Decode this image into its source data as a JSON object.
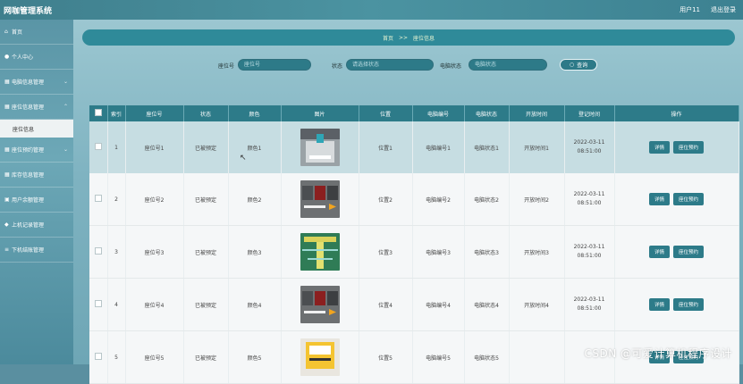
{
  "app": {
    "title": "网咖管理系统",
    "user": "用户11",
    "logout": "退出登录"
  },
  "sidebar": {
    "items": [
      {
        "label": "首页",
        "icon": "home-icon"
      },
      {
        "label": "个人中心",
        "icon": "user-icon"
      },
      {
        "label": "电脑信息管理",
        "icon": "grid-icon"
      },
      {
        "label": "座位信息管理",
        "icon": "grid-icon"
      },
      {
        "label": "座位预约管理",
        "icon": "grid-icon"
      },
      {
        "label": "库存信息管理",
        "icon": "grid-icon"
      },
      {
        "label": "用户余额管理",
        "icon": "wallet-icon"
      },
      {
        "label": "上机记录管理",
        "icon": "car-icon"
      },
      {
        "label": "下机结账管理",
        "icon": "list-icon"
      }
    ],
    "sub_active": "座位信息"
  },
  "breadcrumb": {
    "home": "首页",
    "sep": ">>",
    "current": "座位信息"
  },
  "search": {
    "seat_label": "座位号",
    "seat_placeholder": "座位号",
    "status_label": "状态",
    "status_placeholder": "请选择状态",
    "pc_status_label": "电脑状态",
    "pc_status_placeholder": "电脑状态",
    "query_label": "查询"
  },
  "table": {
    "headers": [
      "",
      "索引",
      "座位号",
      "状态",
      "颜色",
      "图片",
      "位置",
      "电脑编号",
      "电脑状态",
      "开放时间",
      "登记时间",
      "操作"
    ],
    "rows": [
      {
        "index": "1",
        "seat": "座位号1",
        "status": "已被预定",
        "color": "颜色1",
        "location": "位置1",
        "pc_no": "电脑编号1",
        "pc_status": "电脑状态1",
        "open_time": "开放时间1",
        "reg_time": "2022-03-11 08:51:00"
      },
      {
        "index": "2",
        "seat": "座位号2",
        "status": "已被预定",
        "color": "颜色2",
        "location": "位置2",
        "pc_no": "电脑编号2",
        "pc_status": "电脑状态2",
        "open_time": "开放时间2",
        "reg_time": "2022-03-11 08:51:00"
      },
      {
        "index": "3",
        "seat": "座位号3",
        "status": "已被预定",
        "color": "颜色3",
        "location": "位置3",
        "pc_no": "电脑编号3",
        "pc_status": "电脑状态3",
        "open_time": "开放时间3",
        "reg_time": "2022-03-11 08:51:00"
      },
      {
        "index": "4",
        "seat": "座位号4",
        "status": "已被预定",
        "color": "颜色4",
        "location": "位置4",
        "pc_no": "电脑编号4",
        "pc_status": "电脑状态4",
        "open_time": "开放时间4",
        "reg_time": "2022-03-11 08:51:00"
      },
      {
        "index": "5",
        "seat": "座位号5",
        "status": "已被预定",
        "color": "颜色5",
        "location": "位置5",
        "pc_no": "电脑编号5",
        "pc_status": "电脑状态5",
        "open_time": "",
        "reg_time": ""
      }
    ],
    "detail_label": "详情",
    "reserve_label": "座位预约"
  },
  "watermark": "CSDN @可爱计算机程序设计",
  "colors": {
    "accent": "#2d7b89",
    "header_bg": "#3f7f8d",
    "breadcrumb_text": "#e7f4d2"
  }
}
